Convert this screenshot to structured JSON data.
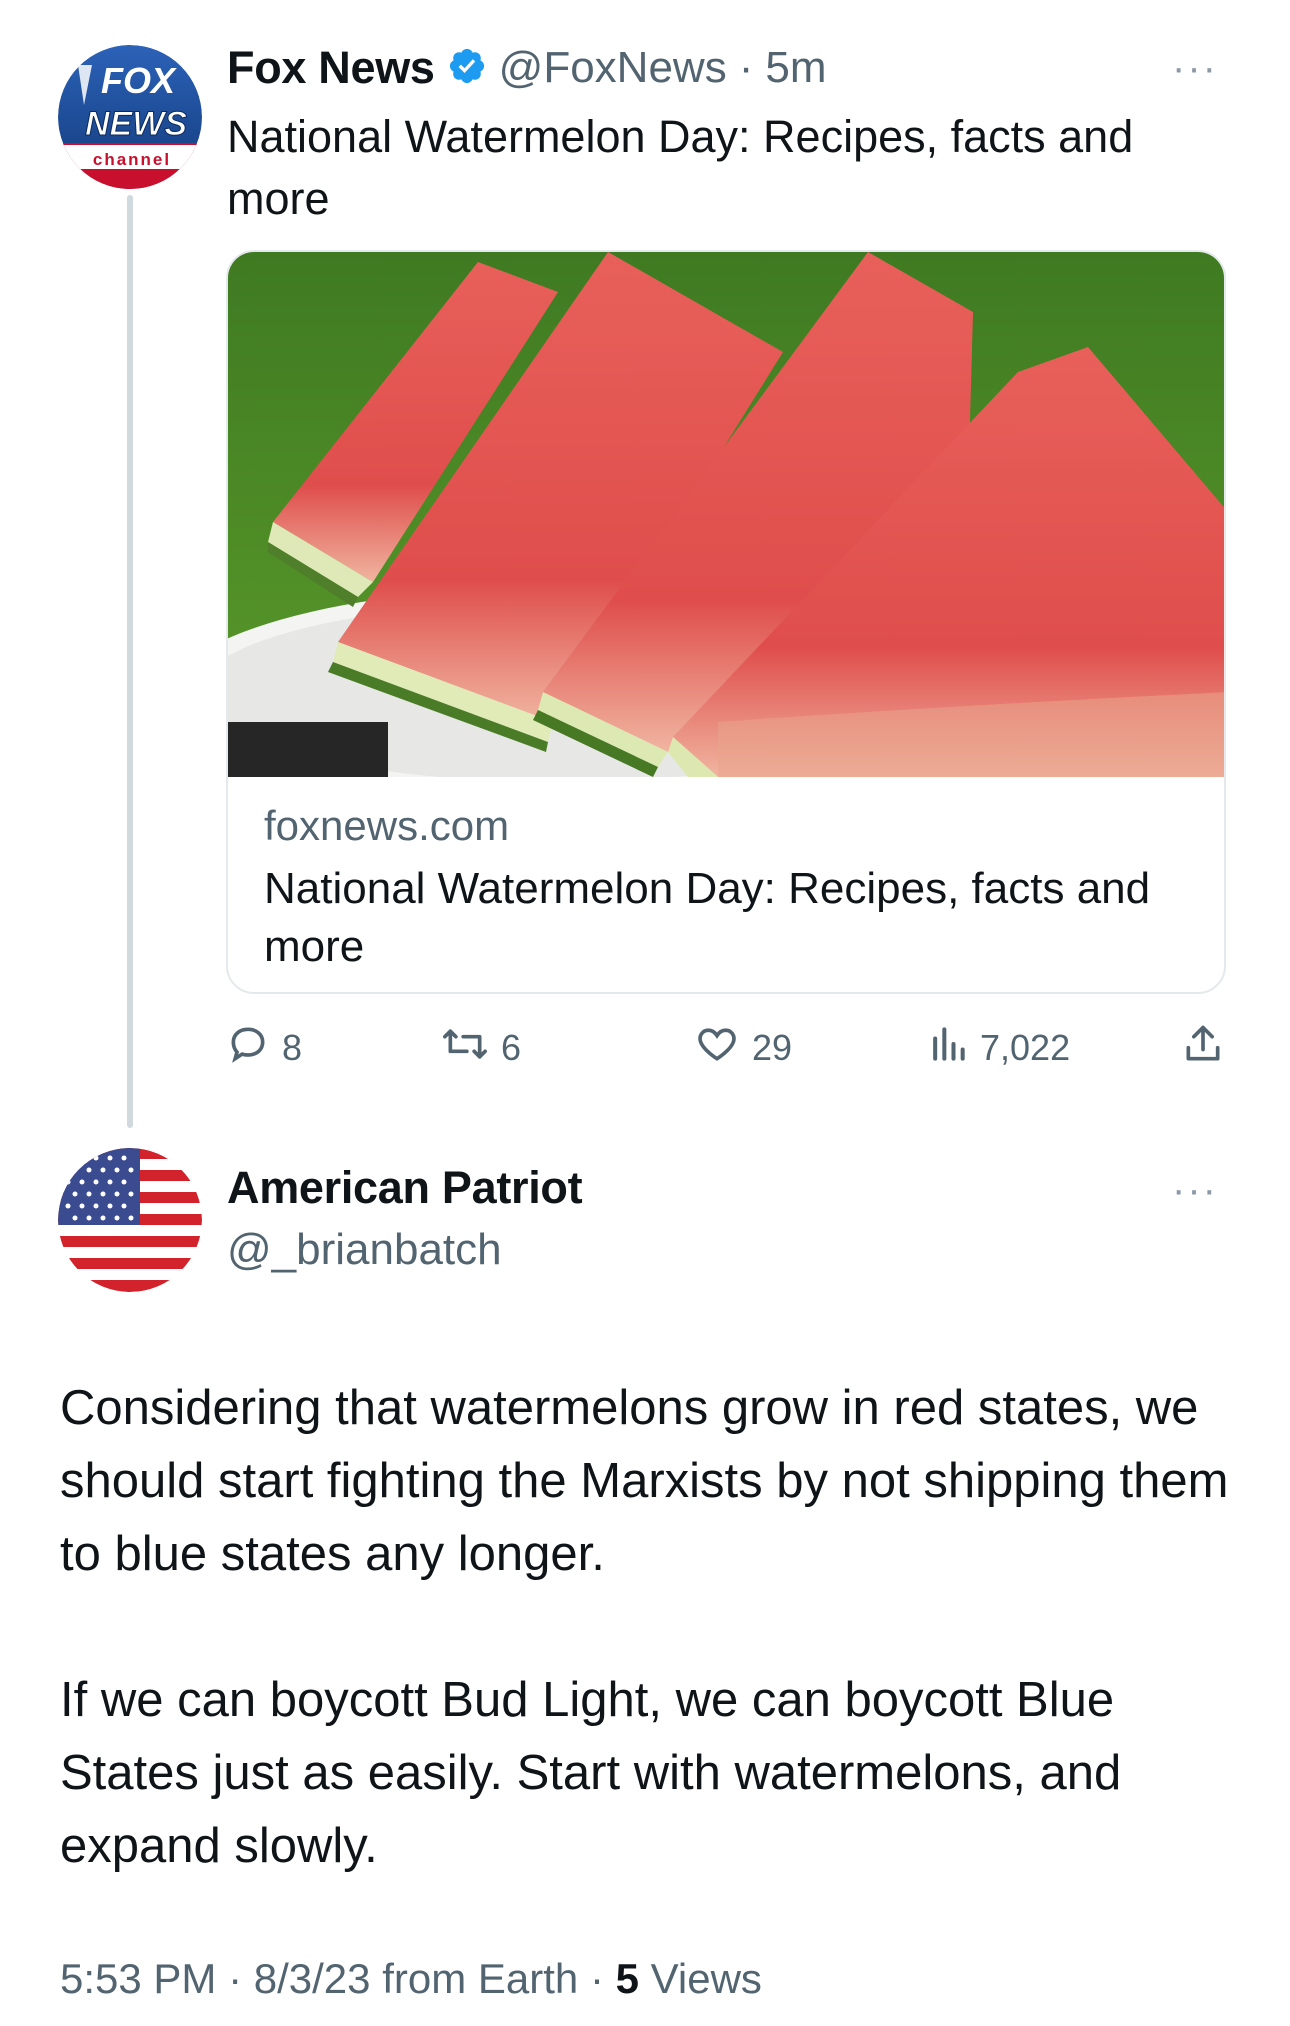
{
  "parent_tweet": {
    "author_name": "Fox News",
    "handle": "@FoxNews",
    "separator": "·",
    "time": "5m",
    "more_label": "···",
    "avatar": {
      "line1": "FOX",
      "line2": "NEWS",
      "line3": "channel"
    },
    "text": "National Watermelon Day: Recipes, facts and more",
    "card": {
      "domain": "foxnews.com",
      "title": "National Watermelon Day: Recipes, facts and more"
    },
    "actions": {
      "replies": "8",
      "reposts": "6",
      "likes": "29",
      "views": "7,022"
    }
  },
  "reply_tweet": {
    "author_name": "American Patriot",
    "handle": "@_brianbatch",
    "more_label": "···",
    "paragraphs": [
      "Considering that watermelons grow in red states, we should start fighting the Marxists by not shipping them to blue states any longer.",
      "If we can boycott Bud Light, we can boycott Blue States just as easily. Start with watermelons, and expand slowly."
    ],
    "meta": {
      "time": "5:53 PM",
      "date": "8/3/23",
      "source": "from Earth",
      "views_count": "5",
      "views_label": "Views"
    }
  },
  "colors": {
    "verified_blue": "#1d9bf0",
    "muted_text": "#536471",
    "thread_line": "#cfd9de",
    "fox_blue": "#1f4d99",
    "fox_red": "#c8102e"
  }
}
